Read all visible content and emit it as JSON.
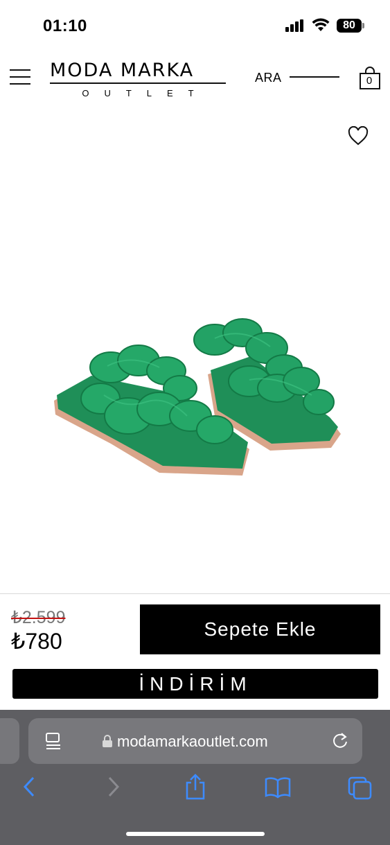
{
  "status_bar": {
    "time": "01:10",
    "battery": "80"
  },
  "header": {
    "logo_main": "MODA MARKA",
    "logo_sub": "OUTLET",
    "search_label": "ARA",
    "cart_count": "0"
  },
  "product": {
    "image": "green-braided-slide-sandals",
    "old_price": "₺2.599",
    "new_price": "₺780",
    "add_to_cart_label": "Sepete Ekle",
    "sale_label": "İNDİRİM"
  },
  "browser": {
    "url": "modamarkaoutlet.com"
  },
  "colors": {
    "accent": "#000000",
    "product_green": "#1f9a5d",
    "sole": "#d9a58a",
    "strike": "#c41212",
    "browser_chrome": "#5e5e62",
    "browser_icon_blue": "#3d8bff"
  },
  "icons": {
    "menu": "hamburger-menu-icon",
    "cart": "shopping-bag-icon",
    "favorite": "heart-icon",
    "reader": "reader-mode-icon",
    "lock": "lock-icon",
    "reload": "reload-icon",
    "back": "back-chevron-icon",
    "forward": "forward-chevron-icon",
    "share": "share-icon",
    "bookmarks": "book-icon",
    "tabs": "tabs-icon"
  }
}
